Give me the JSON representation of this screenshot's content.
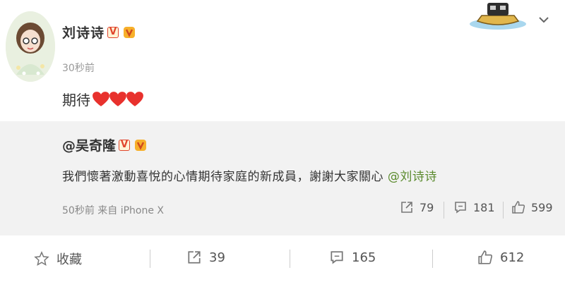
{
  "post": {
    "author": "刘诗诗",
    "verified_mark": "V",
    "time": "30秒前",
    "text": "期待"
  },
  "repost": {
    "author": "@吴奇隆",
    "verified_mark": "V",
    "text_before": "我們懷著激動喜悅的心情期待家庭的新成員，謝謝大家關心 ",
    "mention": "@刘诗诗",
    "meta": "50秒前 来自 iPhone X",
    "reposts": "79",
    "comments": "181",
    "likes": "599"
  },
  "footer": {
    "favorite_label": "收藏",
    "reposts": "39",
    "comments": "165",
    "likes": "612"
  },
  "colors": {
    "heart": "#e8312d",
    "mention": "#5a8a2c",
    "repost_bg": "#f2f2f2"
  }
}
